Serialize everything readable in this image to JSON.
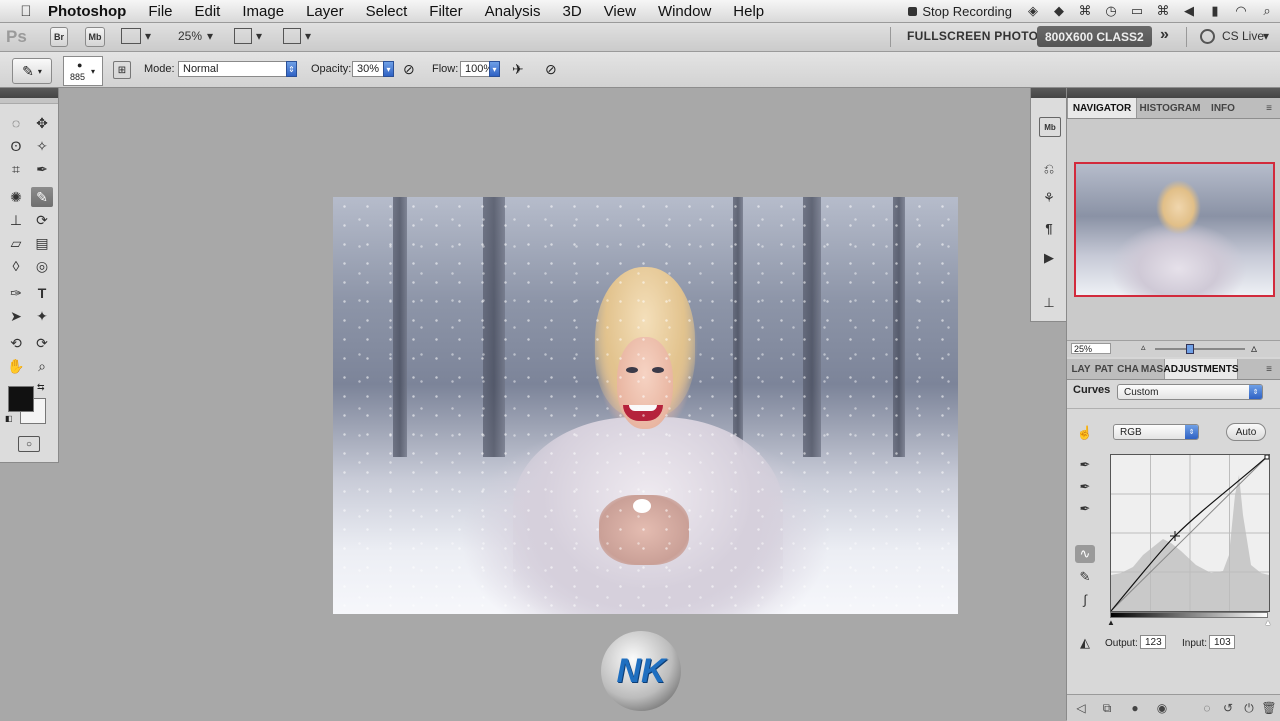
{
  "menubar": {
    "apple_icon": "",
    "app_name": "Photoshop",
    "menus": [
      "File",
      "Edit",
      "Image",
      "Layer",
      "Select",
      "Filter",
      "Analysis",
      "3D",
      "View",
      "Window",
      "Help"
    ],
    "recording_label": "Stop Recording"
  },
  "appbar": {
    "ps_label": "Ps",
    "br_label": "Br",
    "mb_label": "Mb",
    "zoom": "25%",
    "workspace_fullscreen": "FULLSCREEN PHOTO",
    "workspace_active": "800X600 CLASS2",
    "more_label": "»",
    "cs_live": "CS Live"
  },
  "options": {
    "brush_size": "885",
    "mode_label": "Mode:",
    "mode_value": "Normal",
    "opacity_label": "Opacity:",
    "opacity_value": "30%",
    "flow_label": "Flow:",
    "flow_value": "100%"
  },
  "navigator": {
    "tabs": [
      "NAVIGATOR",
      "HISTOGRAM",
      "INFO"
    ],
    "zoom": "25%"
  },
  "adjustments": {
    "tabs": [
      "LAY",
      "PAT",
      "CHA",
      "MAS",
      "ADJUSTMENTS"
    ],
    "title": "Curves",
    "preset": "Custom",
    "channel": "RGB",
    "auto_label": "Auto",
    "output_label": "Output:",
    "output_value": "123",
    "input_label": "Input:",
    "input_value": "103"
  },
  "colors": {
    "foreground": "#111111",
    "background": "#f4f4f4",
    "nav_frame": "#d22a3c"
  },
  "icons": {
    "tools": [
      "marquee-icon",
      "move-icon",
      "lasso-icon",
      "magic-wand-icon",
      "crop-icon",
      "eyedropper-icon",
      "spot-heal-icon",
      "brush-icon",
      "stamp-icon",
      "history-brush-icon",
      "eraser-icon",
      "gradient-icon",
      "blur-icon",
      "dodge-icon",
      "pen-icon",
      "type-icon",
      "path-select-icon",
      "shape-icon",
      "3d-rotate-icon",
      "3d-orbit-icon",
      "hand-icon",
      "zoom-icon"
    ]
  }
}
